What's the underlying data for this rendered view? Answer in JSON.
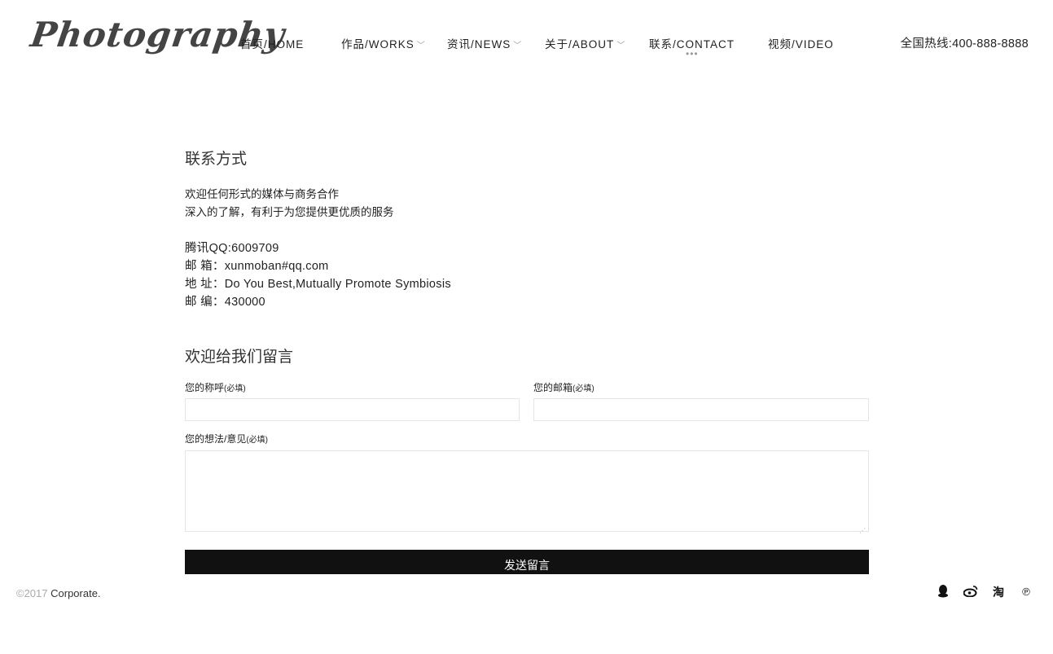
{
  "header": {
    "logo": "Photography",
    "nav": [
      {
        "label": "首页/HOME",
        "has_dropdown": false
      },
      {
        "label": "作品/WORKS",
        "has_dropdown": true
      },
      {
        "label": "资讯/NEWS",
        "has_dropdown": true
      },
      {
        "label": "关于/ABOUT",
        "has_dropdown": true
      },
      {
        "label": "联系/CONTACT",
        "has_dropdown": false,
        "active": true
      },
      {
        "label": "视频/VIDEO",
        "has_dropdown": false
      }
    ],
    "active_indicator": "•••",
    "hotline": "全国热线:400-888-8888"
  },
  "contact": {
    "title": "联系方式",
    "intro": [
      "欢迎任何形式的媒体与商务合作",
      "深入的了解，有利于为您提供更优质的服务"
    ],
    "lines": [
      "腾讯QQ:6009709",
      "邮 箱：xunmoban#qq.com",
      "地 址：Do You Best,Mutually Promote Symbiosis",
      "邮 编：430000"
    ]
  },
  "form": {
    "title": "欢迎给我们留言",
    "name_label": "您的称呼",
    "email_label": "您的邮箱",
    "message_label": "您的想法/意见",
    "required_note": "(必填)",
    "name_value": "",
    "email_value": "",
    "message_value": "",
    "submit_label": "发送留言"
  },
  "footer": {
    "year": "©2017",
    "brand": "Corporate.",
    "social_icons": [
      "qq-icon",
      "weibo-icon",
      "taobao-icon",
      "pinterest-icon"
    ]
  }
}
